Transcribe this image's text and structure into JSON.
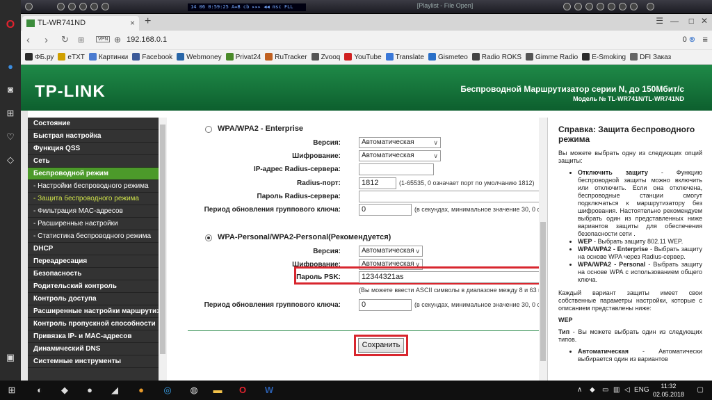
{
  "player": {
    "lcd": "14    06    0:59:25    A↔B cb ▸▸▸ ◀◀   msc  FLL",
    "playlist_title": "[Playlist - File Open]"
  },
  "browser": {
    "tab_title": "TL-WR741ND",
    "tab_close": "×",
    "new_tab": "+",
    "url": "192.168.0.1",
    "vpn_label": "VPN",
    "adblock_count": "0"
  },
  "bookmarks": [
    {
      "label": "ФБ.ру",
      "color": "#2b2b2b"
    },
    {
      "label": "eTXT",
      "color": "#d0a000"
    },
    {
      "label": "Картинки",
      "color": "#4a7bd0"
    },
    {
      "label": "Facebook",
      "color": "#3b5998"
    },
    {
      "label": "Webmoney",
      "color": "#2966a8"
    },
    {
      "label": "Privat24",
      "color": "#4a8a2a"
    },
    {
      "label": "RuTracker",
      "color": "#c06020"
    },
    {
      "label": "Zvooq",
      "color": "#555555"
    },
    {
      "label": "YouTube",
      "color": "#d02020"
    },
    {
      "label": "Translate",
      "color": "#3a78d8"
    },
    {
      "label": "Gismeteo",
      "color": "#2a70c8"
    },
    {
      "label": "Radio ROKS",
      "color": "#444444"
    },
    {
      "label": "Gimme Radio",
      "color": "#555555"
    },
    {
      "label": "E-Smoking",
      "color": "#2a2a2a"
    },
    {
      "label": "DFI Заказ",
      "color": "#666666"
    }
  ],
  "router": {
    "logo": "TP-LINK",
    "product": "Беспроводной Маршрутизатор серии N, до 150Мбит/с",
    "model": "Модель № TL-WR741N/TL-WR741ND",
    "menu": [
      {
        "label": "Состояние",
        "kind": "item"
      },
      {
        "label": "Быстрая настройка",
        "kind": "item"
      },
      {
        "label": "Функция QSS",
        "kind": "item"
      },
      {
        "label": "Сеть",
        "kind": "item"
      },
      {
        "label": "Беспроводной режим",
        "kind": "active"
      },
      {
        "label": "- Настройки беспроводного режима",
        "kind": "sub"
      },
      {
        "label": "- Защита беспроводного режима",
        "kind": "sub sel"
      },
      {
        "label": "- Фильтрация MAC-адресов",
        "kind": "sub"
      },
      {
        "label": "- Расширенные настройки",
        "kind": "sub"
      },
      {
        "label": "- Статистика беспроводного режима",
        "kind": "sub"
      },
      {
        "label": "DHCP",
        "kind": "item"
      },
      {
        "label": "Переадресация",
        "kind": "item"
      },
      {
        "label": "Безопасность",
        "kind": "item"
      },
      {
        "label": "Родительский контроль",
        "kind": "item"
      },
      {
        "label": "Контроль доступа",
        "kind": "item"
      },
      {
        "label": "Расширенные настройки маршрутизации",
        "kind": "item"
      },
      {
        "label": "Контроль пропускной способности",
        "kind": "item"
      },
      {
        "label": "Привязка IP- и MAC-адресов",
        "kind": "item"
      },
      {
        "label": "Динамический DNS",
        "kind": "item"
      },
      {
        "label": "Системные инструменты",
        "kind": "item"
      }
    ],
    "enterprise": {
      "title": "WPA/WPA2 - Enterprise",
      "version_label": "Версия:",
      "version_value": "Автоматическая",
      "cipher_label": "Шифрование:",
      "cipher_value": "Автоматическая",
      "radius_ip_label": "IP-адрес Radius-сервера:",
      "radius_ip_value": "",
      "radius_port_label": "Radius-порт:",
      "radius_port_value": "1812",
      "radius_port_hint": "(1-65535, 0 означает порт по умолчанию 1812)",
      "radius_pass_label": "Пароль Radius-сервера:",
      "radius_pass_value": "",
      "group_key_label": "Период обновления группового ключа:",
      "group_key_value": "0",
      "group_key_hint": "(в секундах, минимальное значение 30, 0 с"
    },
    "personal": {
      "title": "WPA-Personal/WPA2-Personal(Рекомендуется)",
      "version_label": "Версия:",
      "version_value": "Автоматическая",
      "cipher_label": "Шифрование:",
      "cipher_value": "Автоматическая",
      "psk_label": "Пароль PSK:",
      "psk_value": "12344321as",
      "psk_hint": "(Вы можете ввести ASCII символы в диапазоне между 8 и 63 и",
      "group_key_label": "Период обновления группового ключа:",
      "group_key_value": "0",
      "group_key_hint": "(в секундах, минимальное значение 30, 0 с"
    },
    "save_button": "Сохранить",
    "help": {
      "title": "Справка: Защита беспроводного режима",
      "intro": "Вы можете выбрать одну из следующих опций защиты:",
      "items": [
        {
          "term": "Отключить защиту",
          "text": " - Функцию беспроводной защиты можно включить или отключить. Если она отключена, беспроводные станции смогут подключаться к маршрутизатору без шифрования. Настоятельно рекомендуем выбрать один из представленных ниже вариантов защиты для обеспечения безопасности сети ."
        },
        {
          "term": "WEP",
          "text": " - Выбрать защиту 802.11 WEP."
        },
        {
          "term": "WPA/WPA2 - Enterprise",
          "text": " - Выбрать защиту на основе WPA через Radius-сервер."
        },
        {
          "term": "WPA/WPA2 - Personal",
          "text": " - Выбрать защиту на основе WPA с использованием общего ключа."
        }
      ],
      "para2": "Каждый вариант защиты имеет свои собственные параметры настройки, которые с описанием представлены ниже:",
      "wep_head": "WEP",
      "type_term": "Тип",
      "type_text": " - Вы можете выбрать один из следующих типов.",
      "auto_term": "Автоматическая",
      "auto_text": " - Автоматически выбирается один из вариантов"
    }
  },
  "taskbar": {
    "lang": "ENG",
    "time": "11:32",
    "date": "02.05.2018"
  }
}
